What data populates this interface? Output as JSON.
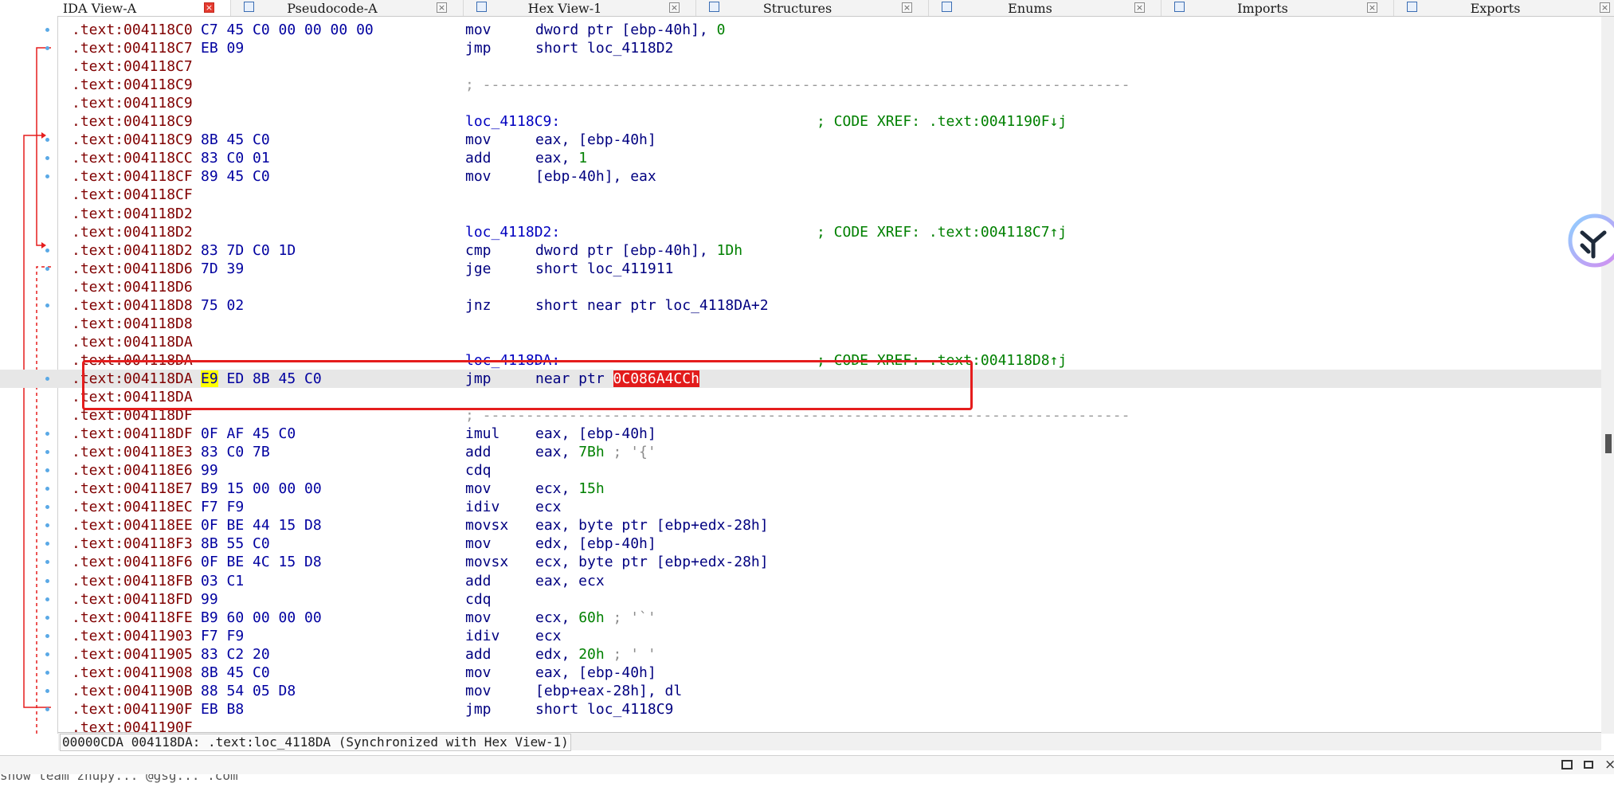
{
  "tabs": [
    {
      "label": "IDA View-A",
      "active": true
    },
    {
      "label": "Pseudocode-A",
      "active": false
    },
    {
      "label": "Hex View-1",
      "active": false
    },
    {
      "label": "Structures",
      "active": false
    },
    {
      "label": "Enums",
      "active": false
    },
    {
      "label": "Imports",
      "active": false
    },
    {
      "label": "Exports",
      "active": false
    }
  ],
  "rows": [
    {
      "addr": ".text:004118C0",
      "bytes": "C7 45 C0 00 00 00 00",
      "mnem": "mov",
      "ops": "dword ptr [ebp-40h], ",
      "imm": "0",
      "dot": true
    },
    {
      "addr": ".text:004118C7",
      "bytes": "EB 09",
      "mnem": "jmp",
      "ops": "short loc_4118D2",
      "dot": true
    },
    {
      "addr": ".text:004118C7"
    },
    {
      "addr": ".text:004118C9",
      "sep": "; ---------------------------------------------------------------------------"
    },
    {
      "addr": ".text:004118C9"
    },
    {
      "addr": ".text:004118C9",
      "label": "loc_4118C9:",
      "xref": "; CODE XREF: .text:0041190F↓j"
    },
    {
      "addr": ".text:004118C9",
      "bytes": "8B 45 C0",
      "mnem": "mov",
      "ops": "eax, [ebp-40h]",
      "dot": true
    },
    {
      "addr": ".text:004118CC",
      "bytes": "83 C0 01",
      "mnem": "add",
      "ops": "eax, ",
      "imm": "1",
      "dot": true
    },
    {
      "addr": ".text:004118CF",
      "bytes": "89 45 C0",
      "mnem": "mov",
      "ops": "[ebp-40h], eax",
      "dot": true
    },
    {
      "addr": ".text:004118CF"
    },
    {
      "addr": ".text:004118D2"
    },
    {
      "addr": ".text:004118D2",
      "label": "loc_4118D2:",
      "xref": "; CODE XREF: .text:004118C7↑j"
    },
    {
      "addr": ".text:004118D2",
      "bytes": "83 7D C0 1D",
      "mnem": "cmp",
      "ops": "dword ptr [ebp-40h], ",
      "imm": "1Dh",
      "dot": true
    },
    {
      "addr": ".text:004118D6",
      "bytes": "7D 39",
      "mnem": "jge",
      "ops": "short loc_411911",
      "dot": true
    },
    {
      "addr": ".text:004118D6"
    },
    {
      "addr": ".text:004118D8",
      "bytes": "75 02",
      "mnem": "jnz",
      "ops": "short near ptr loc_4118DA+2",
      "dot": true
    },
    {
      "addr": ".text:004118D8"
    },
    {
      "addr": ".text:004118DA"
    },
    {
      "addr": ".text:004118DA",
      "label": "loc_4118DA:",
      "xref": "; CODE XREF: .text:004118D8↑j"
    },
    {
      "addr": ".text:004118DA",
      "bytes_hl": "E9",
      "bytes": " ED 8B 45 C0",
      "mnem": "jmp",
      "ops": "near ptr ",
      "err": "0C086A4CCh",
      "dot": true,
      "selected": true
    },
    {
      "addr": ".text:004118DA"
    },
    {
      "addr": ".text:004118DF",
      "sep": "; ---------------------------------------------------------------------------"
    },
    {
      "addr": ".text:004118DF",
      "bytes": "0F AF 45 C0",
      "mnem": "imul",
      "ops": "eax, [ebp-40h]",
      "dot": true
    },
    {
      "addr": ".text:004118E3",
      "bytes": "83 C0 7B",
      "mnem": "add",
      "ops": "eax, ",
      "imm": "7Bh",
      "cmt": " ; '{'",
      "dot": true
    },
    {
      "addr": ".text:004118E6",
      "bytes": "99",
      "mnem": "cdq",
      "ops": "",
      "dot": true
    },
    {
      "addr": ".text:004118E7",
      "bytes": "B9 15 00 00 00",
      "mnem": "mov",
      "ops": "ecx, ",
      "imm": "15h",
      "dot": true
    },
    {
      "addr": ".text:004118EC",
      "bytes": "F7 F9",
      "mnem": "idiv",
      "ops": "ecx",
      "dot": true
    },
    {
      "addr": ".text:004118EE",
      "bytes": "0F BE 44 15 D8",
      "mnem": "movsx",
      "ops": "eax, byte ptr [ebp+edx-28h]",
      "dot": true
    },
    {
      "addr": ".text:004118F3",
      "bytes": "8B 55 C0",
      "mnem": "mov",
      "ops": "edx, [ebp-40h]",
      "dot": true
    },
    {
      "addr": ".text:004118F6",
      "bytes": "0F BE 4C 15 D8",
      "mnem": "movsx",
      "ops": "ecx, byte ptr [ebp+edx-28h]",
      "dot": true
    },
    {
      "addr": ".text:004118FB",
      "bytes": "03 C1",
      "mnem": "add",
      "ops": "eax, ecx",
      "dot": true
    },
    {
      "addr": ".text:004118FD",
      "bytes": "99",
      "mnem": "cdq",
      "ops": "",
      "dot": true
    },
    {
      "addr": ".text:004118FE",
      "bytes": "B9 60 00 00 00",
      "mnem": "mov",
      "ops": "ecx, ",
      "imm": "60h",
      "cmt": " ; '`'",
      "dot": true
    },
    {
      "addr": ".text:00411903",
      "bytes": "F7 F9",
      "mnem": "idiv",
      "ops": "ecx",
      "dot": true
    },
    {
      "addr": ".text:00411905",
      "bytes": "83 C2 20",
      "mnem": "add",
      "ops": "edx, ",
      "imm": "20h",
      "cmt": " ; ' '",
      "dot": true
    },
    {
      "addr": ".text:00411908",
      "bytes": "8B 45 C0",
      "mnem": "mov",
      "ops": "eax, [ebp-40h]",
      "dot": true
    },
    {
      "addr": ".text:0041190B",
      "bytes": "88 54 05 D8",
      "mnem": "mov",
      "ops": "[ebp+eax-28h], dl",
      "dot": true
    },
    {
      "addr": ".text:0041190F",
      "bytes": "EB B8",
      "mnem": "jmp",
      "ops": "short loc_4118C9",
      "dot": true
    },
    {
      "addr": ".text:0041190F"
    }
  ],
  "status": {
    "address_line": "00000CDA 004118DA: .text:loc_4118DA (Synchronized with Hex View-1)"
  },
  "console": {
    "partial_line": "show  team  zhupy... @gsg...  .com"
  },
  "colors": {
    "highlight_box": "#e51d1d",
    "address": "#800000",
    "bytes": "#0000a0",
    "xref": "#008000"
  }
}
